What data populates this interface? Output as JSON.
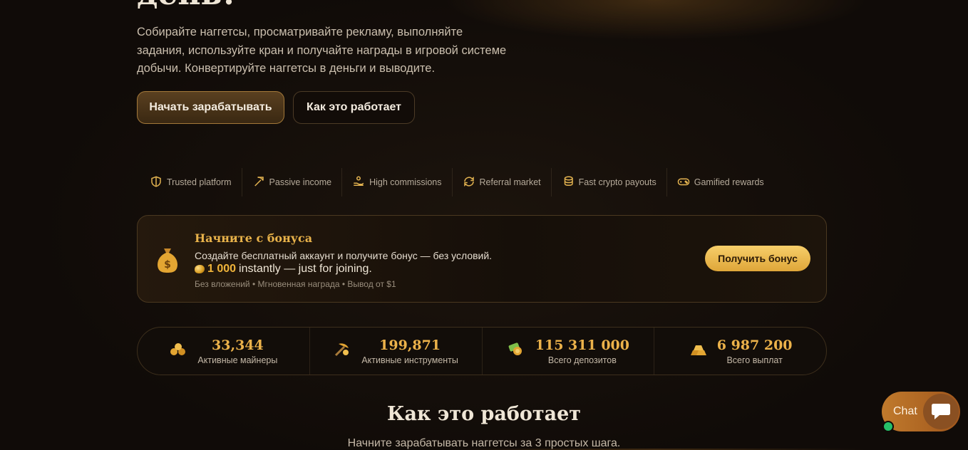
{
  "hero": {
    "title_partial": "день!",
    "description": "Собирайте наггетсы, просматривайте рекламу, выполняйте задания, используйте кран и получайте награды в игровой системе добычи. Конвертируйте наггетсы в деньги и выводите.",
    "primary_button": "Начать зарабатывать",
    "secondary_button": "Как это работает"
  },
  "features": [
    {
      "label": "Trusted platform",
      "icon": "shield-icon"
    },
    {
      "label": "Passive income",
      "icon": "pickaxe-icon"
    },
    {
      "label": "High commissions",
      "icon": "hand-coin-icon"
    },
    {
      "label": "Referral market",
      "icon": "refresh-icon"
    },
    {
      "label": "Fast crypto payouts",
      "icon": "coins-icon"
    },
    {
      "label": "Gamified rewards",
      "icon": "gamepad-icon"
    }
  ],
  "bonus": {
    "icon": "money-bag-icon",
    "title": "Начните с бонуса",
    "description": "Создайте бесплатный аккаунт и получите бонус — без условий.",
    "amount": "1 000",
    "amount_suffix": "instantly — just for joining.",
    "note": "Без вложений • Мгновенная награда • Вывод от $1",
    "button": "Получить бонус"
  },
  "stats": [
    {
      "value": "33,344",
      "label": "Активные майнеры",
      "icon": "gold-pile-icon"
    },
    {
      "value": "199,871",
      "label": "Активные инструменты",
      "icon": "pickaxe-gold-icon"
    },
    {
      "value": "115 311 000",
      "label": "Всего депозитов",
      "icon": "money-deposit-icon"
    },
    {
      "value": "6 987 200",
      "label": "Всего выплат",
      "icon": "gold-bars-icon"
    }
  ],
  "how_it_works": {
    "title": "Как это работает",
    "subtitle": "Начните зарабатывать наггетсы за 3 простых шага."
  },
  "chat": {
    "label": "Chat"
  },
  "colors": {
    "accent": "#ecb24a",
    "background": "#120d09",
    "online": "#26c069"
  }
}
